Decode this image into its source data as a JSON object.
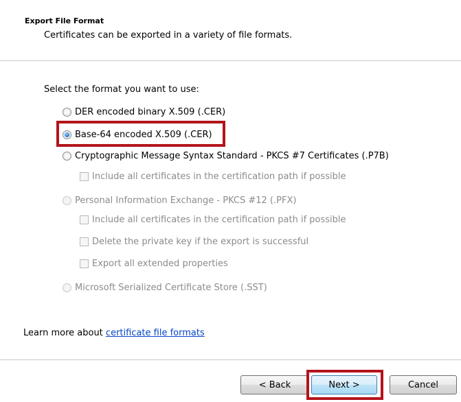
{
  "header": {
    "title": "Export File Format",
    "subtitle": "Certificates can be exported in a variety of file formats."
  },
  "prompt": "Select the format you want to use:",
  "formats": [
    {
      "label": "DER encoded binary X.509 (.CER)",
      "selected": false,
      "enabled": true
    },
    {
      "label": "Base-64 encoded X.509 (.CER)",
      "selected": true,
      "enabled": true
    },
    {
      "label": "Cryptographic Message Syntax Standard - PKCS #7 Certificates (.P7B)",
      "selected": false,
      "enabled": true
    },
    {
      "label": "Personal Information Exchange - PKCS #12 (.PFX)",
      "selected": false,
      "enabled": false
    },
    {
      "label": "Microsoft Serialized Certificate Store (.SST)",
      "selected": false,
      "enabled": false
    }
  ],
  "pkcs7_options": [
    {
      "label": "Include all certificates in the certification path if possible",
      "checked": false,
      "enabled": false
    }
  ],
  "pfx_options": [
    {
      "label": "Include all certificates in the certification path if possible",
      "checked": false,
      "enabled": false
    },
    {
      "label": "Delete the private key if the export is successful",
      "checked": false,
      "enabled": false
    },
    {
      "label": "Export all extended properties",
      "checked": false,
      "enabled": false
    }
  ],
  "learn_more": {
    "prefix": "Learn more about ",
    "link_text": "certificate file formats"
  },
  "buttons": {
    "back": "< Back",
    "next": "Next >",
    "cancel": "Cancel"
  },
  "colors": {
    "highlight": "#b3141b",
    "link": "#0645c9",
    "disabled_text": "#8b8b8b"
  }
}
